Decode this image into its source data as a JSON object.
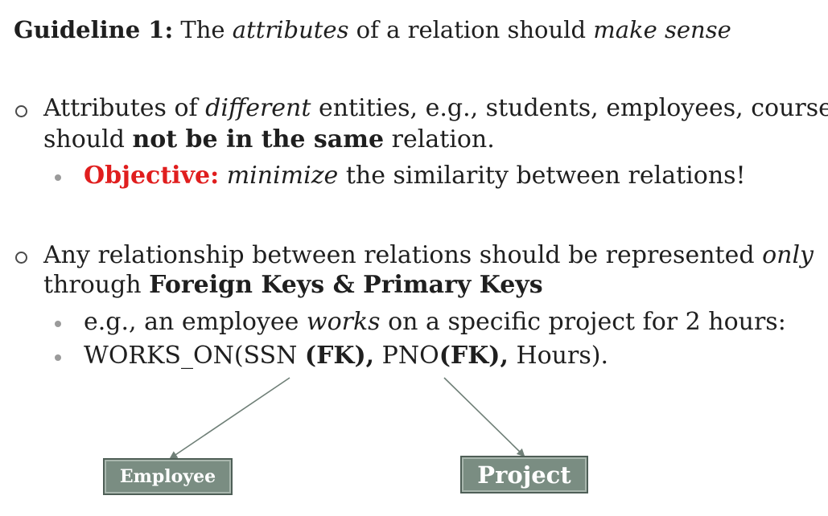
{
  "title": {
    "label": "Guideline 1:",
    "pre": " The ",
    "em1": "attributes",
    "mid": " of a relation should ",
    "em2": "make sense"
  },
  "bullet1": {
    "pre": "Attributes of ",
    "em": "different",
    "post": " entities, e.g., students, employees, courses,",
    "line2_pre": "should ",
    "line2_strong": "not be in the same",
    "line2_post": " relation.",
    "sub": {
      "label": "Objective:",
      "em": "minimize",
      "post": " the similarity between relations!"
    }
  },
  "bullet2": {
    "pre": "Any relationship between relations should be represented ",
    "em": "only",
    "line2_pre": "through ",
    "line2_strong": "Foreign Keys & Primary Keys",
    "sub1": {
      "pre": "e.g., an employee ",
      "em": "works",
      "post": " on a specific project for 2 hours:"
    },
    "sub2": {
      "a": "WORKS_ON(SSN ",
      "b": "(FK),",
      "c": " PNO",
      "d": "(FK),",
      "e": " Hours)."
    }
  },
  "diagram": {
    "employee": "Employee",
    "project": "Project"
  },
  "colors": {
    "accent_red": "#e01e1e",
    "box_fill": "#7a8d82",
    "arrow": "#6f7f77"
  }
}
